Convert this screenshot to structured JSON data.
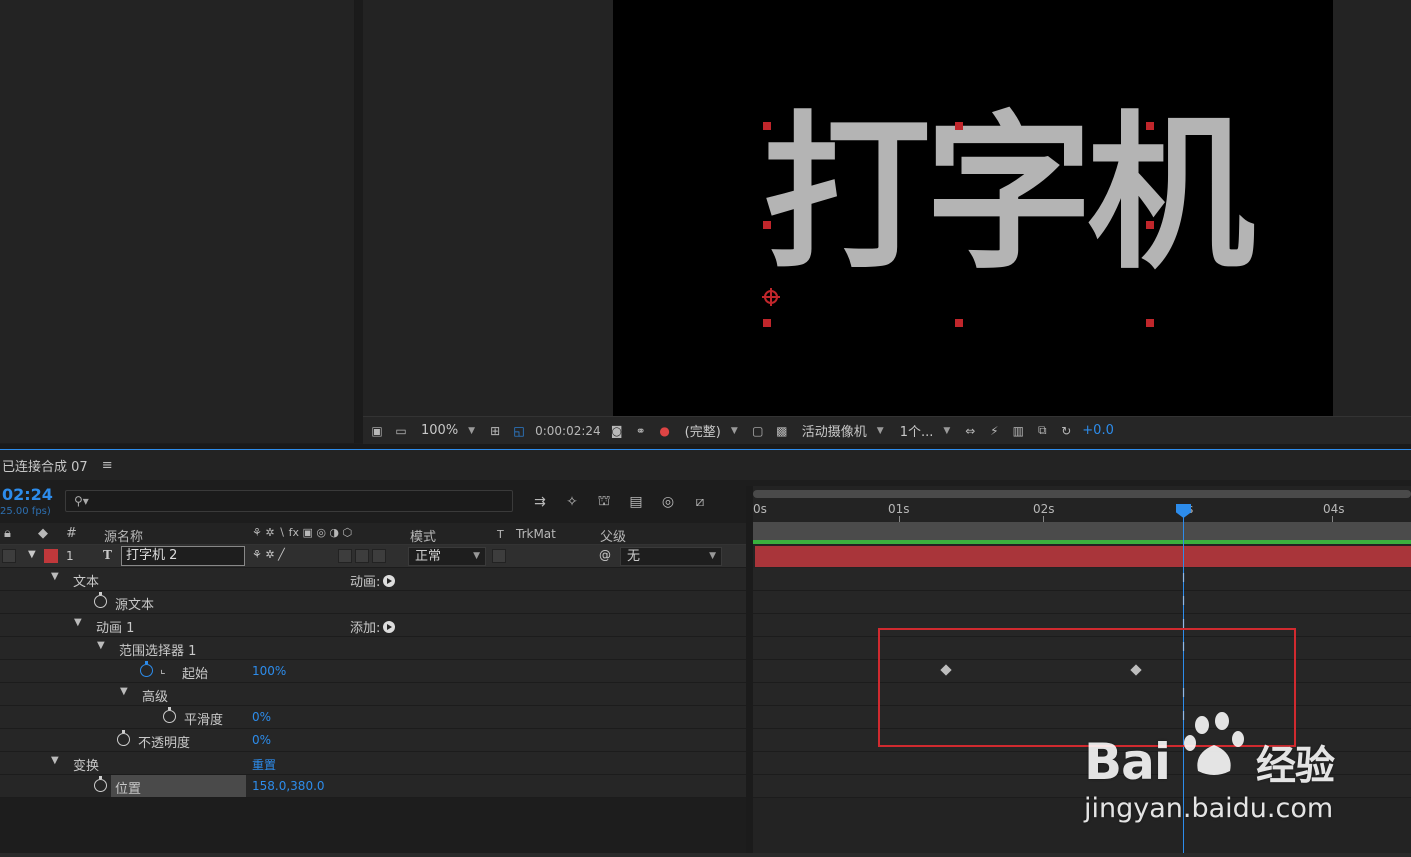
{
  "viewer": {
    "comp_text": "打字机",
    "toolbar": {
      "zoom": "100%",
      "timecode": "0:00:02:24",
      "resolution": "(完整)",
      "camera": "活动摄像机",
      "views": "1个...",
      "exposure": "+0.0"
    }
  },
  "timeline": {
    "tab_title": "已连接合成 07",
    "tab_menu": "≡",
    "timecode": "02:24",
    "fps": "25.00 fps)",
    "search_placeholder": "",
    "columns": {
      "num": "#",
      "source_name": "源名称",
      "mode": "模式",
      "t": "T",
      "trkmat": "TrkMat",
      "parent": "父级"
    },
    "layer": {
      "index": "1",
      "type_glyph": "T",
      "name": "打字机 2",
      "mode": "正常",
      "parent": "无"
    },
    "properties": [
      {
        "label": "文本",
        "action": "动画:"
      },
      {
        "label": "源文本"
      },
      {
        "label": "动画 1",
        "action": "添加:"
      },
      {
        "label": "范围选择器 1"
      },
      {
        "label": "起始",
        "value": "100%"
      },
      {
        "label": "高级"
      },
      {
        "label": "平滑度",
        "value": "0%"
      },
      {
        "label": "不透明度",
        "value": "0%"
      },
      {
        "label": "变换",
        "value": "重置"
      },
      {
        "label": "位置",
        "value": "158.0,380.0"
      }
    ],
    "ruler": [
      "0s",
      "01s",
      "02s",
      "s",
      "04s"
    ],
    "current_time_seconds": 2.96,
    "keyframes_seconds": [
      1.32,
      2.65
    ]
  },
  "colors": {
    "accent": "#2d8ceb",
    "layer_label": "#c0383b",
    "layer_bar": "#a9353a",
    "highlight": "#d12a2f",
    "work_area_green": "#3ab03e"
  },
  "watermark": {
    "brand": "Bai",
    "brand_suffix": "经验",
    "url": "jingyan.baidu.com"
  }
}
